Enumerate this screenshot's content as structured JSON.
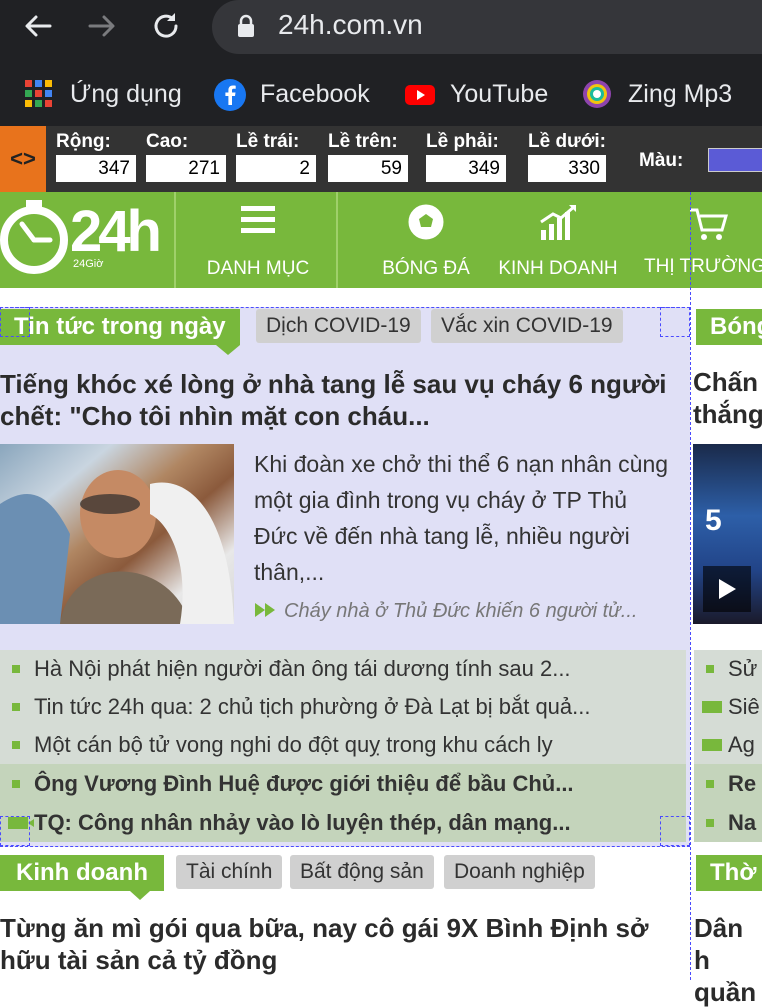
{
  "browser": {
    "url": "24h.com.vn",
    "bookmarks": [
      {
        "label": "Ứng dụng",
        "icon": "apps-grid-icon"
      },
      {
        "label": "Facebook",
        "icon": "facebook-icon"
      },
      {
        "label": "YouTube",
        "icon": "youtube-icon"
      },
      {
        "label": "Zing Mp3",
        "icon": "zing-mp3-icon"
      }
    ]
  },
  "ruler": {
    "toggle_label": "<>",
    "fields": [
      {
        "label": "Rộng:",
        "value": "347"
      },
      {
        "label": "Cao:",
        "value": "271"
      },
      {
        "label": "Lề trái:",
        "value": "2"
      },
      {
        "label": "Lề trên:",
        "value": "59"
      },
      {
        "label": "Lề phải:",
        "value": "349"
      },
      {
        "label": "Lề dưới:",
        "value": "330"
      }
    ],
    "color_label": "Màu:",
    "color_value": "#5b5bd6"
  },
  "site": {
    "logo_text": "24h",
    "logo_sub": "24Giờ",
    "nav": [
      {
        "label": "DANH MỤC",
        "icon": "menu-icon"
      },
      {
        "label": "BÓNG ĐÁ",
        "icon": "soccer-ball-icon"
      },
      {
        "label": "KINH DOANH",
        "icon": "chart-growth-icon"
      },
      {
        "label": "THỊ TRƯỜNG",
        "icon": "shopping-cart-icon"
      }
    ]
  },
  "news_section": {
    "main_tab": "Tin tức trong ngày",
    "sub_tabs": [
      "Dịch COVID-19",
      "Vắc xin COVID-19"
    ],
    "headline": "Tiếng khóc xé lòng ở nhà tang lễ sau vụ cháy 6 người chết: \"Cho tôi nhìn mặt con cháu...",
    "summary": "Khi đoàn xe chở thi thể 6 nạn nhân cùng một gia đình trong vụ cháy ở TP Thủ Đức về đến nhà tang lễ, nhiều người thân,...",
    "related": "Cháy nhà ở Thủ Đức khiến 6 người tử...",
    "items": [
      {
        "text": "Hà Nội phát hiện người đàn ông tái dương tính sau 2...",
        "bold": false,
        "video": false
      },
      {
        "text": "Tin tức 24h qua: 2 chủ tịch phường ở Đà Lạt bị bắt quả...",
        "bold": false,
        "video": false
      },
      {
        "text": "Một cán bộ tử vong nghi do đột quỵ trong khu cách ly",
        "bold": false,
        "video": false
      },
      {
        "text": "Ông Vương Đình Huệ được giới thiệu để bầu Chủ...",
        "bold": true,
        "video": false
      },
      {
        "text": "TQ: Công nhân nhảy vào lò luyện thép, dân mạng...",
        "bold": true,
        "video": true
      }
    ]
  },
  "right_column": {
    "tab": "Bóng",
    "headline_line1": "Chấn",
    "headline_line2": "thắng",
    "items": [
      "Sử",
      "Siê",
      "Ag",
      "Re",
      "Na"
    ],
    "bottom_tab": "Thờ",
    "bottom_line1": "Dân h",
    "bottom_line2": "quần"
  },
  "business_section": {
    "main_tab": "Kinh doanh",
    "sub_tabs": [
      "Tài chính",
      "Bất động sản",
      "Doanh nghiệp"
    ],
    "headline": "Từng ăn mì gói qua bữa, nay cô gái 9X Bình Định sở hữu tài sản cả tỷ đồng"
  },
  "colors": {
    "brand_green": "#78b83c",
    "ruler_orange": "#e8731c",
    "highlight": "#e0e0f6"
  }
}
